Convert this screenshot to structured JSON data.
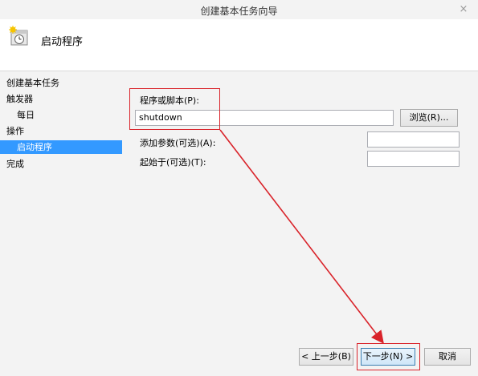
{
  "window": {
    "title": "创建基本任务向导",
    "close_glyph": "×"
  },
  "header": {
    "title": "启动程序",
    "icon": "task-scheduler-icon"
  },
  "sidebar": {
    "items": [
      {
        "label": "创建基本任务"
      },
      {
        "label": "触发器"
      },
      {
        "label": "每日"
      },
      {
        "label": "操作"
      },
      {
        "label": "启动程序"
      },
      {
        "label": "完成"
      }
    ]
  },
  "form": {
    "program_label": "程序或脚本(P):",
    "program_value": "shutdown",
    "browse_label": "浏览(R)...",
    "args_label": "添加参数(可选)(A):",
    "args_value": "",
    "start_in_label": "起始于(可选)(T):",
    "start_in_value": ""
  },
  "footer": {
    "back_label": "< 上一步(B)",
    "next_label": "下一步(N) >",
    "cancel_label": "取消"
  },
  "colors": {
    "selection": "#3399ff",
    "annotation_red": "#d9232a"
  }
}
